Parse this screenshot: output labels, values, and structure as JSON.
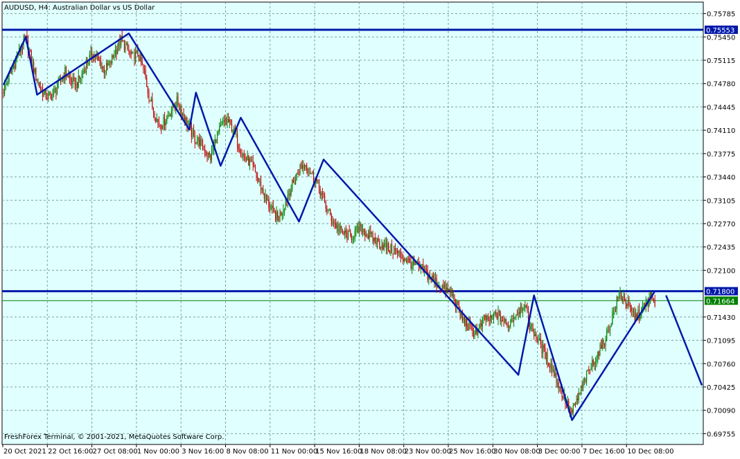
{
  "window": {
    "symbol_title": "AUDUSD, H4:  Australian Dollar vs US Dollar",
    "copyright": "FreshForex Terminal, © 2001-2021, MetaQuotes Software Corp."
  },
  "colors": {
    "background": "#e0ffff",
    "grid": "#7f9f9f",
    "bull_candle": "#008000",
    "bear_candle": "#c00000",
    "trend_lines": "#0018aa",
    "current_price_line": "#008000"
  },
  "chart_data": {
    "type": "candlestick",
    "title": "AUDUSD, H4:  Australian Dollar vs US Dollar",
    "ylim": [
      0.696,
      0.7595
    ],
    "y_ticks": [
      "0.75785",
      "0.75450",
      "0.75115",
      "0.74780",
      "0.74445",
      "0.74110",
      "0.73775",
      "0.73440",
      "0.73105",
      "0.72770",
      "0.72435",
      "0.72100",
      "0.71430",
      "0.71095",
      "0.70760",
      "0.70425",
      "0.70090",
      "0.69755"
    ],
    "x_ticks": [
      "20 Oct 2021",
      "22 Oct 16:00",
      "27 Oct 08:00",
      "1 Nov 00:00",
      "3 Nov 16:00",
      "8 Nov 08:00",
      "11 Nov 00:00",
      "15 Nov 16:00",
      "18 Nov 08:00",
      "23 Nov 00:00",
      "25 Nov 16:00",
      "30 Nov 08:00",
      "3 Dec 00:00",
      "7 Dec 16:00",
      "10 Dec 08:00"
    ],
    "horizontal_levels": [
      {
        "price": 0.75553,
        "label": "0.75553"
      },
      {
        "price": 0.718,
        "label": "0.71800"
      }
    ],
    "current_price": {
      "price": 0.71664,
      "label": "0.71664"
    },
    "close_path": [
      [
        0,
        0.7468
      ],
      [
        7,
        0.7495
      ],
      [
        13,
        0.752
      ],
      [
        20,
        0.754
      ],
      [
        26,
        0.7505
      ],
      [
        30,
        0.7482
      ],
      [
        35,
        0.7465
      ],
      [
        40,
        0.7458
      ],
      [
        45,
        0.7465
      ],
      [
        50,
        0.7478
      ],
      [
        55,
        0.7495
      ],
      [
        60,
        0.7482
      ],
      [
        65,
        0.7476
      ],
      [
        70,
        0.749
      ],
      [
        75,
        0.751
      ],
      [
        80,
        0.7522
      ],
      [
        85,
        0.751
      ],
      [
        90,
        0.7498
      ],
      [
        95,
        0.7505
      ],
      [
        100,
        0.7525
      ],
      [
        105,
        0.754
      ],
      [
        110,
        0.7528
      ],
      [
        115,
        0.7516
      ],
      [
        120,
        0.752
      ],
      [
        126,
        0.7493
      ],
      [
        130,
        0.746
      ],
      [
        134,
        0.744
      ],
      [
        138,
        0.7422
      ],
      [
        142,
        0.742
      ],
      [
        146,
        0.743
      ],
      [
        150,
        0.744
      ],
      [
        155,
        0.7452
      ],
      [
        160,
        0.7435
      ],
      [
        165,
        0.7418
      ],
      [
        170,
        0.74
      ],
      [
        175,
        0.7395
      ],
      [
        180,
        0.738
      ],
      [
        185,
        0.7372
      ],
      [
        190,
        0.74
      ],
      [
        195,
        0.7418
      ],
      [
        200,
        0.7425
      ],
      [
        205,
        0.7412
      ],
      [
        210,
        0.739
      ],
      [
        215,
        0.7372
      ],
      [
        220,
        0.7365
      ],
      [
        225,
        0.735
      ],
      [
        230,
        0.733
      ],
      [
        235,
        0.731
      ],
      [
        240,
        0.7295
      ],
      [
        245,
        0.7284
      ],
      [
        250,
        0.73
      ],
      [
        255,
        0.7322
      ],
      [
        260,
        0.7338
      ],
      [
        265,
        0.7358
      ],
      [
        270,
        0.7362
      ],
      [
        275,
        0.735
      ],
      [
        280,
        0.7336
      ],
      [
        284,
        0.732
      ],
      [
        288,
        0.7302
      ],
      [
        292,
        0.7288
      ],
      [
        296,
        0.7276
      ],
      [
        300,
        0.7268
      ],
      [
        305,
        0.7262
      ],
      [
        310,
        0.7258
      ],
      [
        315,
        0.7265
      ],
      [
        320,
        0.727
      ],
      [
        325,
        0.7262
      ],
      [
        330,
        0.7255
      ],
      [
        335,
        0.725
      ],
      [
        340,
        0.7245
      ],
      [
        345,
        0.724
      ],
      [
        350,
        0.7238
      ],
      [
        355,
        0.723
      ],
      [
        360,
        0.7225
      ],
      [
        365,
        0.7218
      ],
      [
        370,
        0.7215
      ],
      [
        375,
        0.721
      ],
      [
        380,
        0.7202
      ],
      [
        385,
        0.7195
      ],
      [
        390,
        0.7188
      ],
      [
        395,
        0.7182
      ],
      [
        400,
        0.7178
      ],
      [
        405,
        0.716
      ],
      [
        410,
        0.714
      ],
      [
        415,
        0.713
      ],
      [
        420,
        0.7122
      ],
      [
        425,
        0.7125
      ],
      [
        430,
        0.7142
      ],
      [
        435,
        0.7138
      ],
      [
        440,
        0.7148
      ],
      [
        445,
        0.714
      ],
      [
        450,
        0.713
      ],
      [
        455,
        0.7142
      ],
      [
        460,
        0.7152
      ],
      [
        465,
        0.7162
      ],
      [
        470,
        0.7132
      ],
      [
        475,
        0.7118
      ],
      [
        480,
        0.7102
      ],
      [
        485,
        0.7085
      ],
      [
        490,
        0.707
      ],
      [
        495,
        0.705
      ],
      [
        500,
        0.703
      ],
      [
        505,
        0.7012
      ],
      [
        508,
        0.7005
      ],
      [
        512,
        0.7022
      ],
      [
        516,
        0.7038
      ],
      [
        520,
        0.7055
      ],
      [
        525,
        0.7072
      ],
      [
        530,
        0.7088
      ],
      [
        535,
        0.7102
      ],
      [
        540,
        0.7122
      ],
      [
        545,
        0.715
      ],
      [
        550,
        0.7175
      ],
      [
        555,
        0.717
      ],
      [
        560,
        0.7152
      ],
      [
        565,
        0.7142
      ],
      [
        570,
        0.7152
      ],
      [
        575,
        0.7162
      ],
      [
        578,
        0.7172
      ],
      [
        582,
        0.7166
      ]
    ],
    "trend_lines": [
      [
        [
          0,
          0.7476
        ],
        [
          20,
          0.7545
        ],
        [
          30,
          0.7462
        ],
        [
          112,
          0.755
        ],
        [
          166,
          0.7412
        ],
        [
          172,
          0.7465
        ],
        [
          194,
          0.736
        ],
        [
          212,
          0.7429
        ],
        [
          264,
          0.728
        ],
        [
          286,
          0.7369
        ],
        [
          460,
          0.706
        ],
        [
          474,
          0.7174
        ],
        [
          508,
          0.6995
        ],
        [
          582,
          0.718
        ]
      ],
      [
        [
          592,
          0.7174
        ],
        [
          624,
          0.7045
        ]
      ]
    ]
  }
}
